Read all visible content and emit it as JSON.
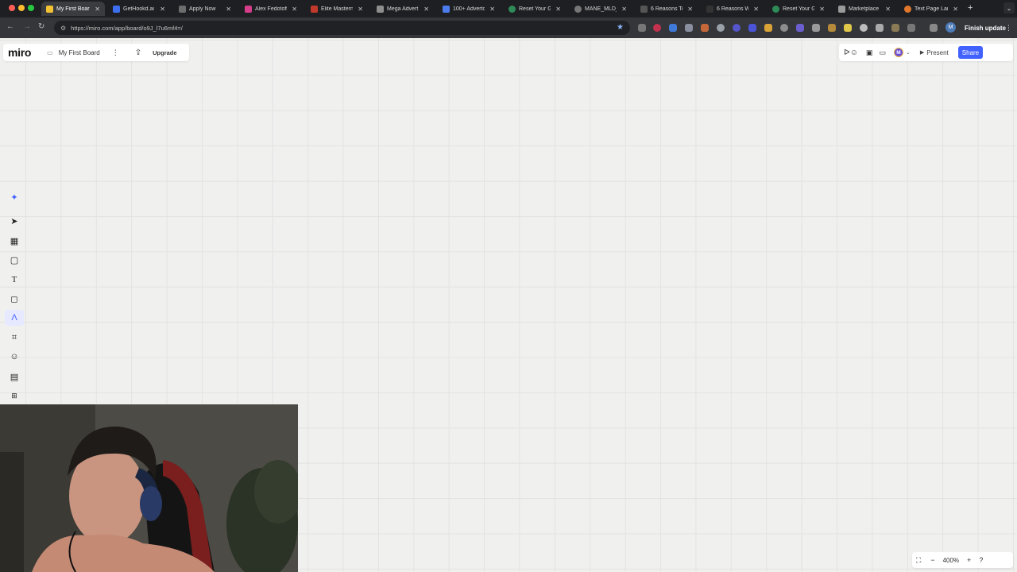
{
  "browser": {
    "tabs": [
      {
        "title": "My First Boar",
        "favicon_color": "#f2c233",
        "active": true
      },
      {
        "title": "GetHookd.ai",
        "favicon_color": "#3c6ff0",
        "active": false
      },
      {
        "title": "Apply Now",
        "favicon_color": "#6d6d6d",
        "active": false
      },
      {
        "title": "Alex Fedotoff",
        "favicon_color": "#d63d8a",
        "active": false
      },
      {
        "title": "Elite Mastern",
        "favicon_color": "#c0392b",
        "active": false
      },
      {
        "title": "Mega Advert",
        "favicon_color": "#8e8e8e",
        "active": false
      },
      {
        "title": "100+ Adverto",
        "favicon_color": "#4b7bec",
        "active": false
      },
      {
        "title": "Reset Your G",
        "favicon_color": "#2e8b57",
        "active": false
      },
      {
        "title": "MANE_MLD_",
        "favicon_color": "#777777",
        "active": false
      },
      {
        "title": "6 Reasons To",
        "favicon_color": "#555555",
        "active": false
      },
      {
        "title": "6 Reasons W",
        "favicon_color": "#333333",
        "active": false
      },
      {
        "title": "Reset Your G",
        "favicon_color": "#2e8b57",
        "active": false
      },
      {
        "title": "Marketplace",
        "favicon_color": "#9a9a9a",
        "active": false
      },
      {
        "title": "Text Page Lan",
        "favicon_color": "#e0772c",
        "active": false
      }
    ],
    "url": "https://miro.com/app/board/o9J_l7u6mf4=/",
    "finish_update_label": "Finish update",
    "profile_initial": "M"
  },
  "board": {
    "logo": "miro",
    "title": "My First Board",
    "upgrade_label": "Upgrade",
    "present_label": "Present",
    "share_label": "Share",
    "avatar_initial": "M",
    "zoom_level": "400%"
  },
  "colors": {
    "accent": "#4262ff",
    "canvas": "#f0f0ef"
  }
}
